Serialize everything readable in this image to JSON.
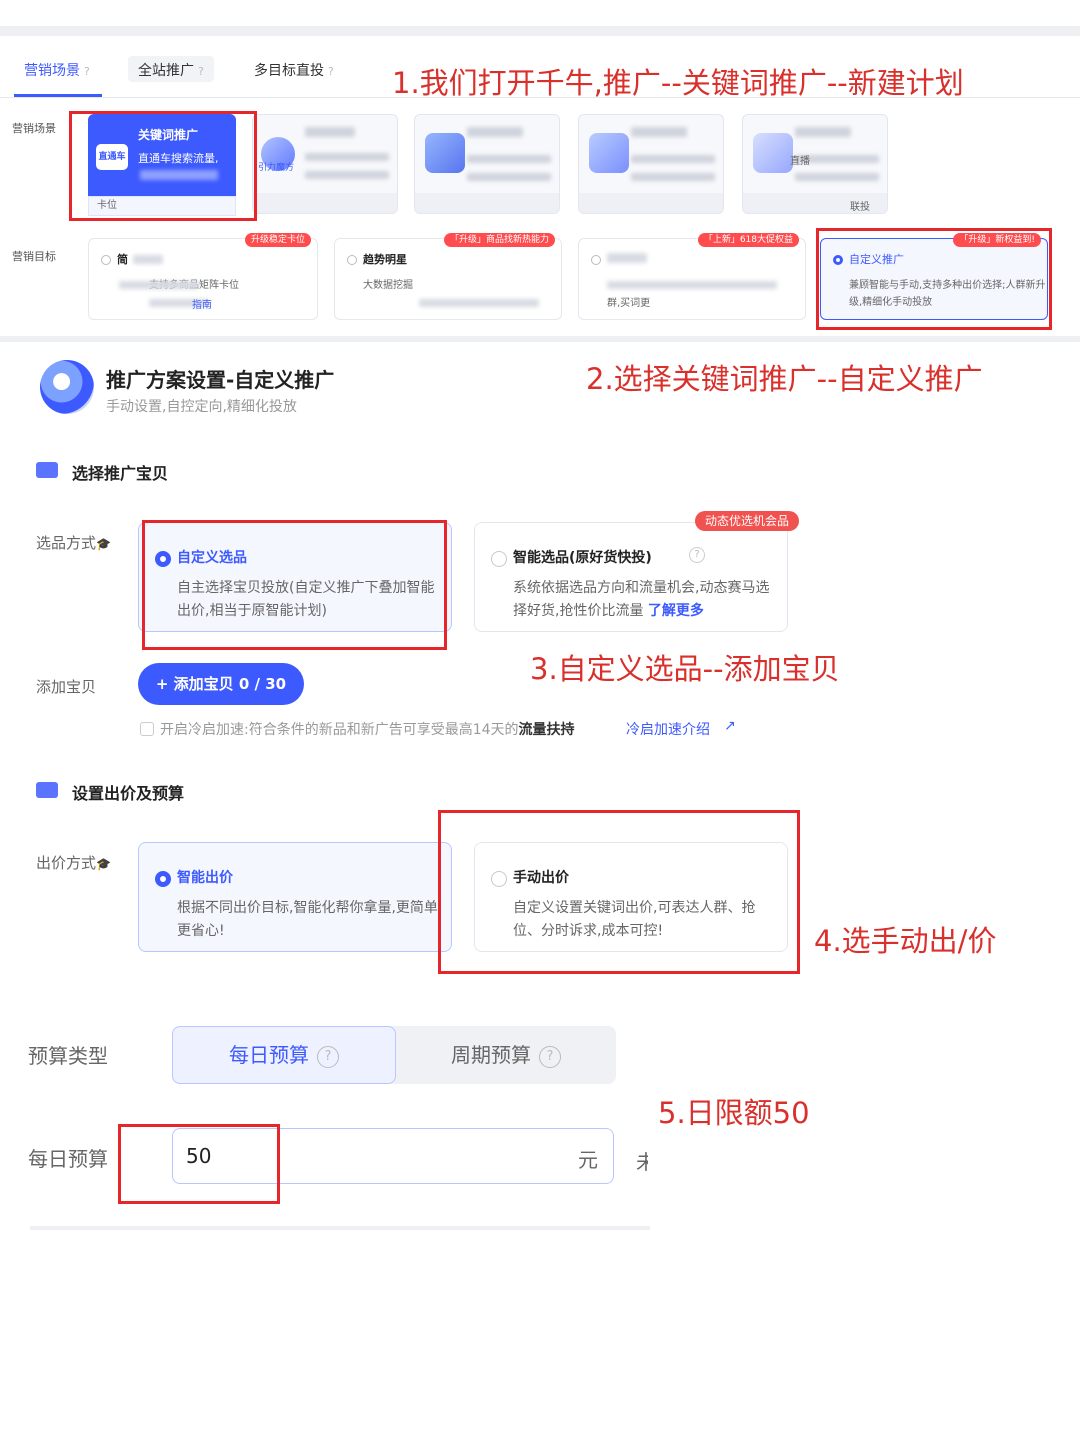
{
  "tabs": {
    "t1": "营销场景",
    "t2": "全站推广",
    "t3": "多目标直投",
    "q": "?"
  },
  "scenes": {
    "row_label": "营销场景",
    "s0_title": "关键词推广",
    "s0_sub": "直通车搜索流量,",
    "s0_badge": "直通车",
    "s0_foot": "卡位",
    "s1_title": "推广",
    "s2_icon_text": "引力魔方",
    "s4_sub": "直播",
    "s4_foot": "联投"
  },
  "goals": {
    "row_label": "营销目标",
    "g1_title": "简",
    "g1_desc": "支持多商品矩阵卡位",
    "g1_link": "指南",
    "g1_tag": "升级稳定卡位",
    "g2_title": "趋势明星",
    "g2_desc": "大数据挖掘",
    "g2_tag": "「升级」商品找新热能力",
    "g3_desc": "群,买词更",
    "g3_tag": "「上新」618大促权益",
    "g4_title": "自定义推广",
    "g4_desc": "兼顾智能与手动,支持多种出价选择;人群新升级,精细化手动投放",
    "g4_tag": "「升级」新权益到!"
  },
  "annotations": {
    "a1": "1.我们打开千牛,推广--关键词推广--新建计划",
    "a2": "2.选择关键词推广--自定义推广",
    "a3": "3.自定义选品--添加宝贝",
    "a4": "4.选手动出/价",
    "a5": "5.日限额50"
  },
  "plan": {
    "title": "推广方案设置-自定义推广",
    "subtitle": "手动设置,自控定向,精细化投放"
  },
  "select_item": {
    "section_title": "选择推广宝贝",
    "mode_label": "选品方式",
    "custom_title": "自定义选品",
    "custom_desc": "自主选择宝贝投放(自定义推广下叠加智能出价,相当于原智能计划)",
    "smart_title": "智能选品(原好货快投)",
    "smart_desc": "系统依据选品方向和流量机会,动态赛马选择好货,抢性价比流量",
    "smart_link": "了解更多",
    "smart_tag": "动态优选机会品",
    "add_label": "添加宝贝",
    "add_button": "+ 添加宝贝 0 / 30",
    "cold_text_pre": "开启冷启加速:符合条件的新品和新广告可享受最高14天的",
    "cold_text_bold": "流量扶持",
    "cold_link": "冷启加速介绍",
    "cold_ext": "↗"
  },
  "bid": {
    "section_title": "设置出价及预算",
    "mode_label": "出价方式",
    "smart_title": "智能出价",
    "smart_desc": "根据不同出价目标,智能化帮你拿量,更简单,更省心!",
    "manual_title": "手动出价",
    "manual_desc": "自定义设置关键词出价,可表达人群、抢位、分时诉求,成本可控!"
  },
  "budget": {
    "type_label": "预算类型",
    "daily_option": "每日预算",
    "period_option": "周期预算",
    "q": "?",
    "daily_label": "每日预算",
    "daily_value": "50",
    "unit": "元",
    "cut_text": "未"
  },
  "colors": {
    "accent": "#3d5afe",
    "annotation_red": "#d9302c",
    "box_red": "#e5262a"
  }
}
